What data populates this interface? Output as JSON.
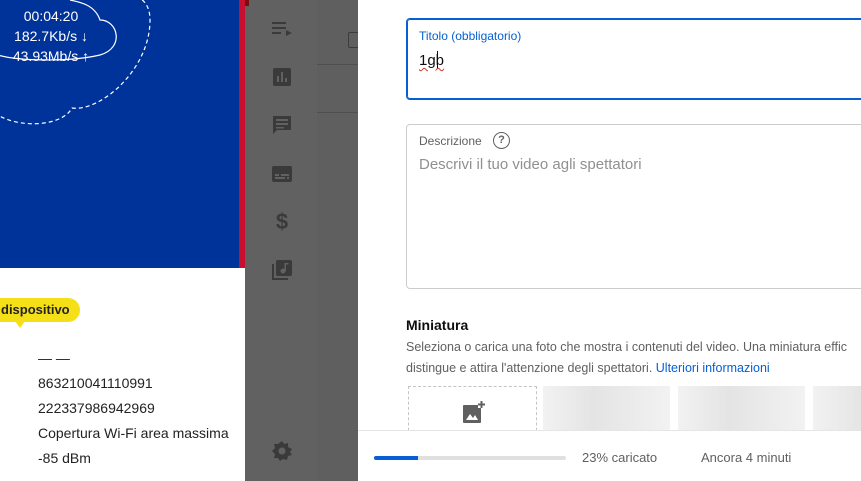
{
  "router": {
    "uptime": "00:04:20",
    "download": "182.7Kb/s ↓",
    "upload": "43.93Mb/s ↑",
    "badge": "dispositivo",
    "info": [
      "— —",
      "863210041110991",
      "222337986942969",
      "Copertura Wi-Fi area massima",
      "-85 dBm"
    ]
  },
  "sidebar": {
    "icons": [
      "playlist-icon",
      "analytics-icon",
      "comments-icon",
      "subtitles-icon",
      "monetization-icon",
      "audio-library-icon",
      "settings-icon"
    ]
  },
  "dialog": {
    "title_label": "Titolo (obbligatorio)",
    "title_value": "1gb",
    "description_label": "Descrizione",
    "description_help": "?",
    "description_placeholder": "Descrivi il tuo video agli spettatori",
    "thumbnail_title": "Miniatura",
    "thumbnail_text_1": "Seleziona o carica una foto che mostra i contenuti del video. Una miniatura effic",
    "thumbnail_text_2": "distingue e attira l'attenzione degli spettatori.",
    "thumbnail_link": "Ulteriori informazioni"
  },
  "footer": {
    "progress_percent": 23,
    "progress_text": "23% caricato",
    "eta_text": "Ancora 4 minuti"
  },
  "colors": {
    "router_blue": "#003399",
    "badge_yellow": "#f5e018",
    "accent": "#065fd4"
  }
}
